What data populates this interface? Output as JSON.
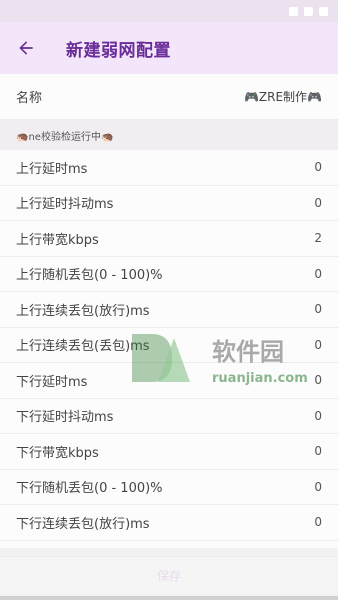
{
  "appbar": {
    "title": "新建弱网配置"
  },
  "name_row": {
    "label": "名称",
    "value": "🎮ZRE制作🎮"
  },
  "section": {
    "label": "🦔ne校验检运行中🦔"
  },
  "params": [
    {
      "label": "上行延时ms",
      "value": "0"
    },
    {
      "label": "上行延时抖动ms",
      "value": "0"
    },
    {
      "label": "上行带宽kbps",
      "value": "2"
    },
    {
      "label": "上行随机丢包(0 - 100)%",
      "value": "0"
    },
    {
      "label": "上行连续丢包(放行)ms",
      "value": "0"
    },
    {
      "label": "上行连续丢包(丢包)ms",
      "value": "0"
    },
    {
      "label": "下行延时ms",
      "value": "0"
    },
    {
      "label": "下行延时抖动ms",
      "value": "0"
    },
    {
      "label": "下行带宽kbps",
      "value": "0"
    },
    {
      "label": "下行随机丢包(0 - 100)%",
      "value": "0"
    },
    {
      "label": "下行连续丢包(放行)ms",
      "value": "0"
    }
  ],
  "save_button": {
    "label": "保存"
  },
  "watermark": {
    "text_cn": "软件园",
    "text_en": "ruanjian.com"
  },
  "colors": {
    "accent": "#6a2d98",
    "appbar_bg": "#f3e6fb",
    "status_bg": "#ece2ef"
  },
  "icons": {
    "back": "arrow-back-icon"
  }
}
